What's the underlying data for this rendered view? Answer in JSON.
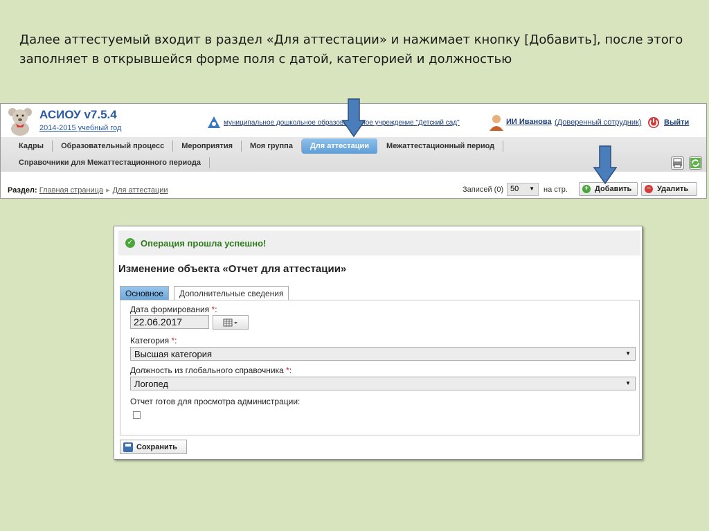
{
  "caption": {
    "line1": "Далее аттестуемый входит в раздел «Для аттестации» и нажимает кнопку [Добавить], после этого",
    "line2": "заполняет в открывшейся форме поля с датой, категорией и должностью"
  },
  "header": {
    "app_title": "АСИОУ v7.5.4",
    "school_year": "2014-2015 учебный год",
    "org_name": "муниципальное дошкольное образовательное учреждение \"Детский сад\"",
    "user_name": "ИИ Иванова",
    "user_role": "(Доверенный сотрудник)",
    "logout": "Выйти"
  },
  "nav": {
    "row1": [
      "Кадры",
      "Образовательный процесс",
      "Мероприятия",
      "Моя группа",
      "Для аттестации",
      "Межаттестационный период"
    ],
    "row2": [
      "Справочники для Межаттестационного периода"
    ],
    "active": "Для аттестации"
  },
  "breadcrumb": {
    "label": "Раздел:",
    "items": [
      "Главная страница",
      "Для аттестации"
    ]
  },
  "records": {
    "label": "Записей (0)",
    "per_page": "50",
    "suffix": "на стр."
  },
  "toolbar": {
    "add": "Добавить",
    "delete": "Удалить"
  },
  "form": {
    "success": "Операция прошла успешно!",
    "title": "Изменение объекта «Отчет для аттестации»",
    "tabs": [
      "Основное",
      "Дополнительные сведения"
    ],
    "date_label": "Дата формирования",
    "date_value": "22.06.2017",
    "category_label": "Категория",
    "category_value": "Высшая категория",
    "position_label": "Должность из глобального справочника",
    "position_value": "Логопед",
    "ready_label": "Отчет готов для просмотра администрации:",
    "required_mark": "*",
    "colon": ":",
    "save": "Сохранить"
  },
  "colors": {
    "slide_bg": "#d7e4bd",
    "arrow_fill": "#4a7ebb",
    "arrow_stroke": "#2c4f7c",
    "active_tab": "#6aa8dc",
    "success_text": "#2f7a1f"
  }
}
